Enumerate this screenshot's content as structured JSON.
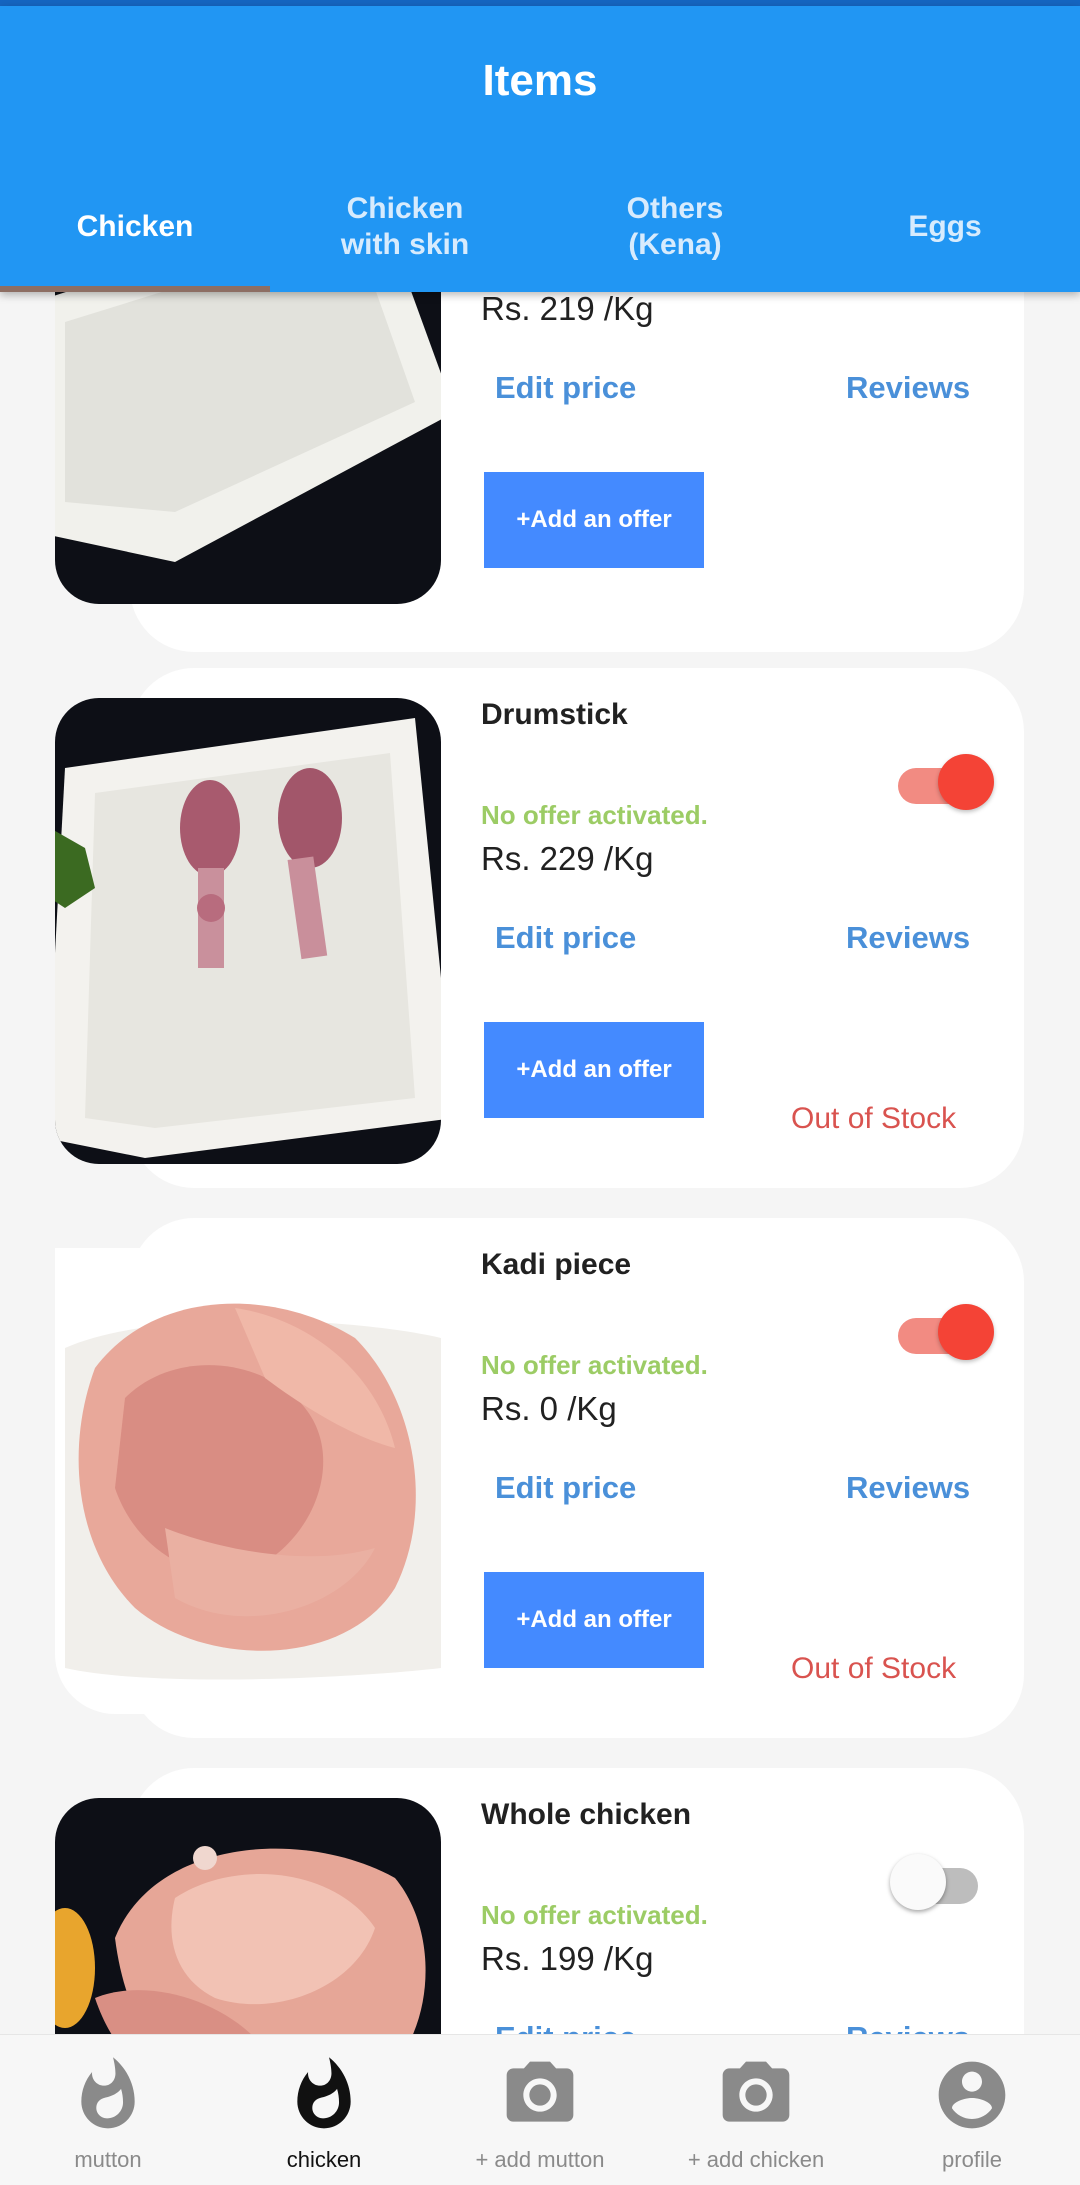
{
  "appbar": {
    "title": "Items"
  },
  "tabs": [
    {
      "label": "Chicken",
      "active": true
    },
    {
      "label": "Chicken\nwith skin",
      "active": false
    },
    {
      "label": "Others\n(Kena)",
      "active": false
    },
    {
      "label": "Eggs",
      "active": false
    }
  ],
  "items": [
    {
      "name": "",
      "offer_status": "",
      "price": "Rs. 219 /Kg",
      "edit_label": "Edit price",
      "reviews_label": "Reviews",
      "add_offer_label": "+Add an offer",
      "stock_status": ""
    },
    {
      "name": "Drumstick",
      "offer_status": "No offer activated.",
      "price": "Rs. 229 /Kg",
      "edit_label": "Edit price",
      "reviews_label": "Reviews",
      "add_offer_label": "+Add an offer",
      "stock_status": "Out of Stock",
      "toggle_on": true
    },
    {
      "name": "Kadi piece",
      "offer_status": "No offer activated.",
      "price": "Rs. 0 /Kg",
      "edit_label": "Edit price",
      "reviews_label": "Reviews",
      "add_offer_label": "+Add an offer",
      "stock_status": "Out of Stock",
      "toggle_on": true
    },
    {
      "name": "Whole chicken",
      "offer_status": "No offer activated.",
      "price": "Rs. 199 /Kg",
      "edit_label": "Edit price",
      "reviews_label": "Reviews",
      "toggle_on": false
    }
  ],
  "bottom_nav": [
    {
      "label": "mutton",
      "icon": "flame-icon",
      "active": false
    },
    {
      "label": "chicken",
      "icon": "flame-icon",
      "active": true
    },
    {
      "label": "+ add mutton",
      "icon": "camera-icon",
      "active": false
    },
    {
      "label": "+ add chicken",
      "icon": "camera-icon",
      "active": false
    },
    {
      "label": "profile",
      "icon": "account-circle-icon",
      "active": false
    }
  ],
  "colors": {
    "appbar": "#2196f3",
    "tab_indicator": "#8d6e63",
    "offer_text": "#9ccc65",
    "link": "#4a90d9",
    "offer_button": "#448aff",
    "out_of_stock": "#d9534f",
    "toggle_on": "#f44336"
  }
}
